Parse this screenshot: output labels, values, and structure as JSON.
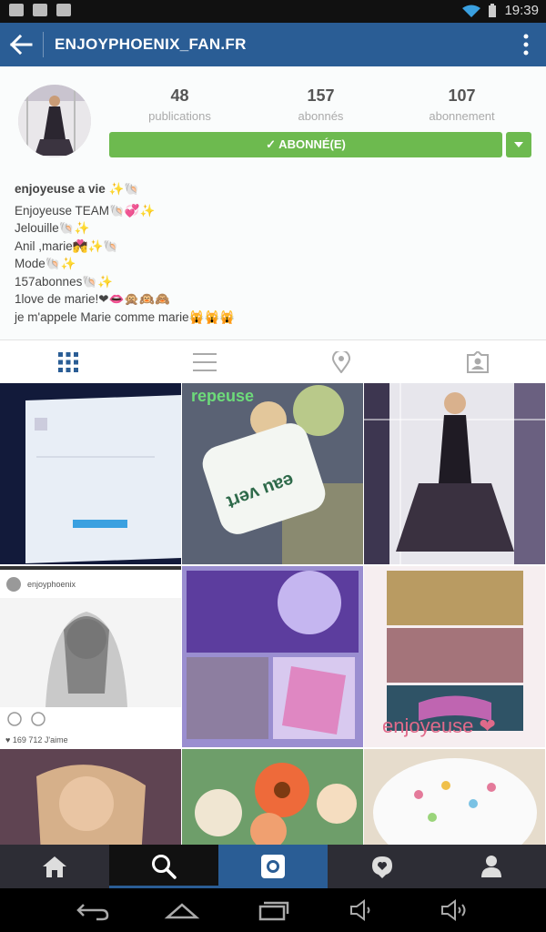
{
  "status_bar": {
    "time": "19:39"
  },
  "app_bar": {
    "title": "ENJOYPHOENIX_FAN.FR"
  },
  "profile": {
    "stats": [
      {
        "count": "48",
        "label": "publications"
      },
      {
        "count": "157",
        "label": "abonnés"
      },
      {
        "count": "107",
        "label": "abonnement"
      }
    ],
    "follow_label": "✓ ABONNÉ(E)",
    "bio_lines": [
      "enjoyeuse a vie ✨🐚",
      "Enjoyeuse TEAM🐚💞✨",
      "Jelouille🐚✨",
      "Anil ,marie💏✨🐚",
      "Mode🐚✨",
      "157abonnes🐚✨",
      "1love de marie!❤👄🙊🙉🙈",
      "je m'appele Marie comme marie🙀🙀🙀"
    ]
  },
  "grid": {
    "post4_user": "enjoyphoenix",
    "post4_likes": "♥ 169 712 J'aime",
    "post6_caption": "enjoyeuse ❤",
    "post2_caption": "repeuse"
  },
  "colors": {
    "app_bar": "#2a5d95",
    "follow": "#6dba4f",
    "bottom_nav": "#2d2d35",
    "selected_tab": "#2a5d95"
  }
}
